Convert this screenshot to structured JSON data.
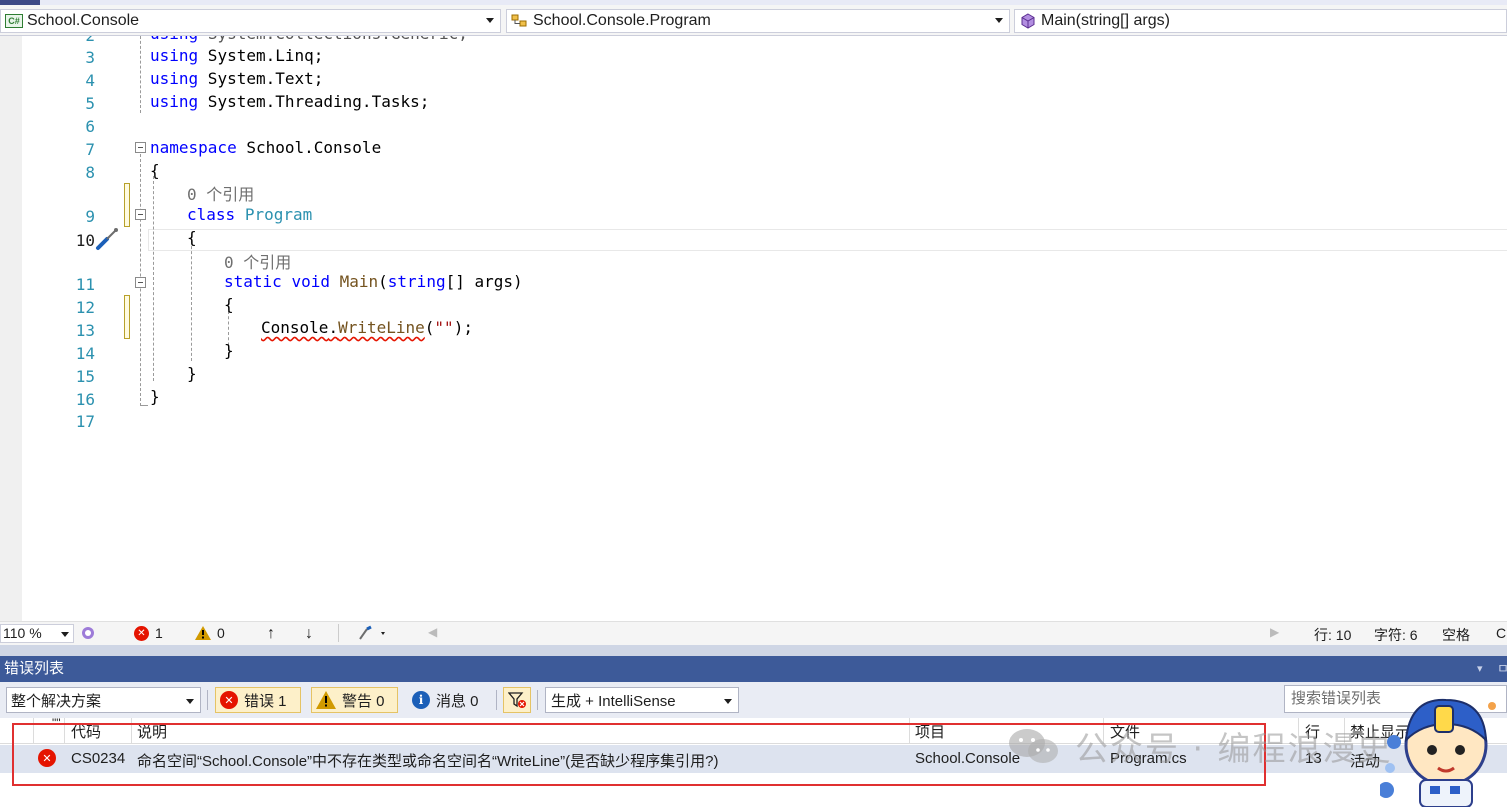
{
  "nav": {
    "project": "School.Console",
    "project_icon": "C#",
    "class": "School.Console.Program",
    "member": "Main(string[] args)"
  },
  "code": {
    "lines": [
      {
        "n": "2",
        "text": "using System.Collections.Generic;"
      },
      {
        "n": "3",
        "kw": "using",
        "rest": " System.Linq;"
      },
      {
        "n": "4",
        "kw": "using",
        "rest": " System.Text;"
      },
      {
        "n": "5",
        "kw": "using",
        "rest": " System.Threading.Tasks;"
      },
      {
        "n": "6"
      },
      {
        "n": "7",
        "kw": "namespace",
        "rest": " School.Console"
      },
      {
        "n": "8",
        "text": "{"
      },
      {
        "n": "9",
        "hint": "0 个引用",
        "kw": "class",
        "type": "Program"
      },
      {
        "n": "10",
        "text": "{"
      },
      {
        "n": "11",
        "hint": "0 个引用",
        "kw1": "static",
        "kw2": "void",
        "fn": "Main",
        "kw3": "string",
        "rest": "[] args)"
      },
      {
        "n": "12",
        "text": "{"
      },
      {
        "n": "13",
        "obj": "Console",
        "method": "WriteLine",
        "str": "\"\"",
        "tail": ");"
      },
      {
        "n": "14",
        "text": "}"
      },
      {
        "n": "15",
        "text": "}"
      },
      {
        "n": "16",
        "text": "}"
      },
      {
        "n": "17"
      }
    ]
  },
  "status": {
    "zoom": "110 %",
    "errors": "1",
    "warnings": "0",
    "line": "行: 10",
    "char": "字符: 6",
    "spaces": "空格",
    "crlf": "CI"
  },
  "errorlist": {
    "title": "错误列表",
    "scope": "整个解决方案",
    "errors_label": "错误 1",
    "warnings_label": "警告 0",
    "messages_label": "消息 0",
    "build_filter": "生成 + IntelliSense",
    "search_placeholder": "搜索错误列表",
    "columns": {
      "code": "代码",
      "description": "说明",
      "project": "项目",
      "file": "文件",
      "line": "行",
      "suppression": "禁止显示"
    },
    "rows": [
      {
        "code": "CS0234",
        "description": "命名空间“School.Console”中不存在类型或命名空间名“WriteLine”(是否缺少程序集引用?)",
        "project": "School.Console",
        "file": "Program.cs",
        "line": "13",
        "suppression": "活动"
      }
    ]
  },
  "watermark": "公众号 · 编程浪漫史",
  "colors": {
    "keyword": "#0000ff",
    "type": "#2b91af",
    "error": "#e51400",
    "panel_title": "#3d5a99",
    "highlight_box": "#e03030"
  }
}
